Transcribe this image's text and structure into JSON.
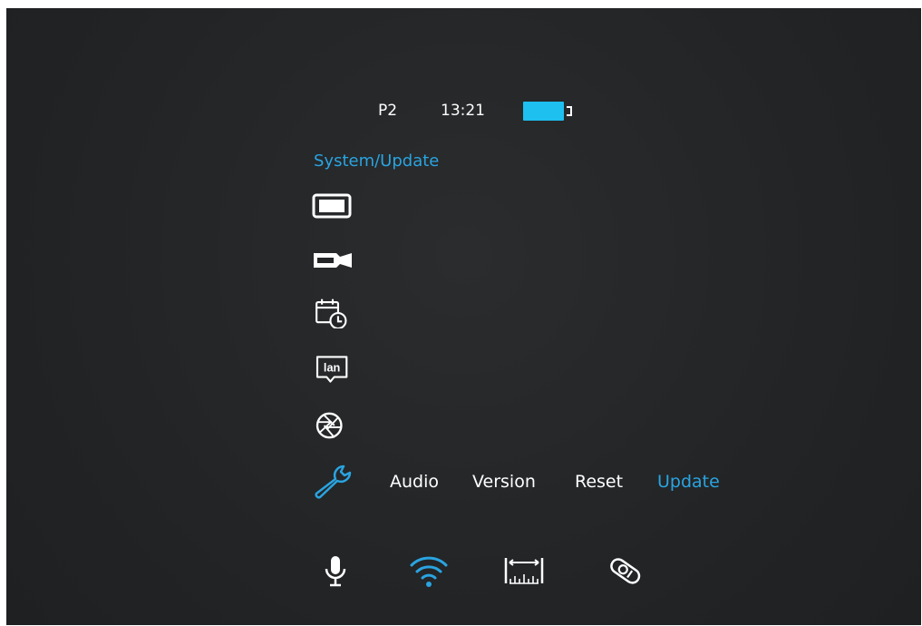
{
  "colors": {
    "accent": "#2aa4e0",
    "battery": "#1ec0f0",
    "text": "#ffffff",
    "background": "#232527"
  },
  "status_bar": {
    "profile": "P2",
    "time": "13:21",
    "battery_icon": "battery-icon"
  },
  "breadcrumb": "System/Update",
  "side_menu": [
    {
      "icon": "display-icon"
    },
    {
      "icon": "camera-icon"
    },
    {
      "icon": "calendar-clock-icon"
    },
    {
      "icon": "lan-icon"
    },
    {
      "icon": "aperture-icon"
    },
    {
      "icon": "wrench-icon",
      "active": true
    }
  ],
  "submenu": [
    {
      "label": "Audio"
    },
    {
      "label": "Version"
    },
    {
      "label": "Reset"
    },
    {
      "label": "Update",
      "active": true
    }
  ],
  "bottom_bar": [
    {
      "icon": "microphone-icon"
    },
    {
      "icon": "wifi-icon",
      "active": true
    },
    {
      "icon": "ruler-range-icon"
    },
    {
      "icon": "laser-rangefinder-icon"
    }
  ]
}
